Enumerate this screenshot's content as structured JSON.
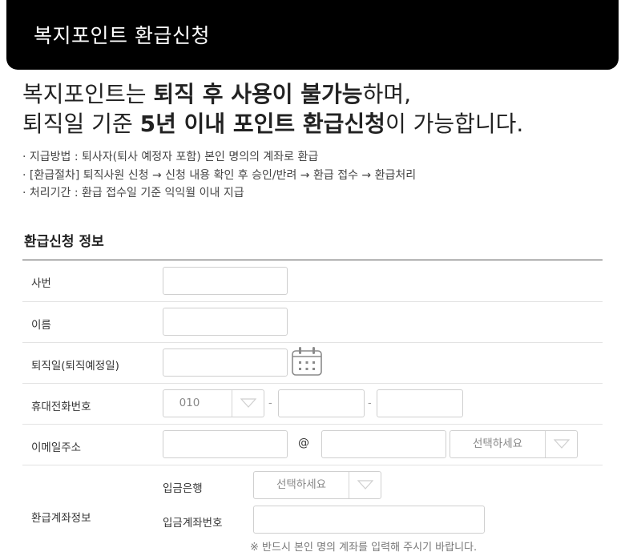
{
  "header": {
    "title": "복지포인트 환급신청"
  },
  "intro": {
    "line1_pre": "복지포인트는 ",
    "line1_bold": "퇴직 후 사용이 불가능",
    "line1_post": "하며,",
    "line2_pre": "퇴직일 기준 ",
    "line2_bold": "5년 이내 포인트 환급신청",
    "line2_post": "이 가능합니다."
  },
  "notes": [
    "· 지급방법 : 퇴사자(퇴사 예정자 포함) 본인 명의의 계좌로 환급",
    "· [환급절차] 퇴직사원 신청 → 신청 내용 확인 후 승인/반려 → 환급 접수 → 환급처리",
    "· 처리기간 : 환급 접수일 기준 익익월 이내 지급"
  ],
  "section_title": "환급신청 정보",
  "form": {
    "employee_no": {
      "label": "사번",
      "value": ""
    },
    "name": {
      "label": "이름",
      "value": ""
    },
    "retire_date": {
      "label": "퇴직일(퇴직예정일)",
      "value": "",
      "icon": "calendar-icon"
    },
    "phone": {
      "label": "휴대전화번호",
      "prefix": "010",
      "separator": "-",
      "middle": "",
      "last": ""
    },
    "email": {
      "label": "이메일주소",
      "local": "",
      "at": "@",
      "domain": "",
      "domain_select": "선택하세요"
    },
    "account": {
      "label": "환급계좌정보",
      "bank_label": "입금은행",
      "bank_select": "선택하세요",
      "number_label": "입금계좌번호",
      "number_value": "",
      "notice": "※ 반드시 본인 명의 계좌를 입력해 주시기 바랍니다."
    }
  },
  "colors": {
    "header_bg": "#000000",
    "header_text": "#ffffff",
    "border": "#cfcfcf"
  }
}
